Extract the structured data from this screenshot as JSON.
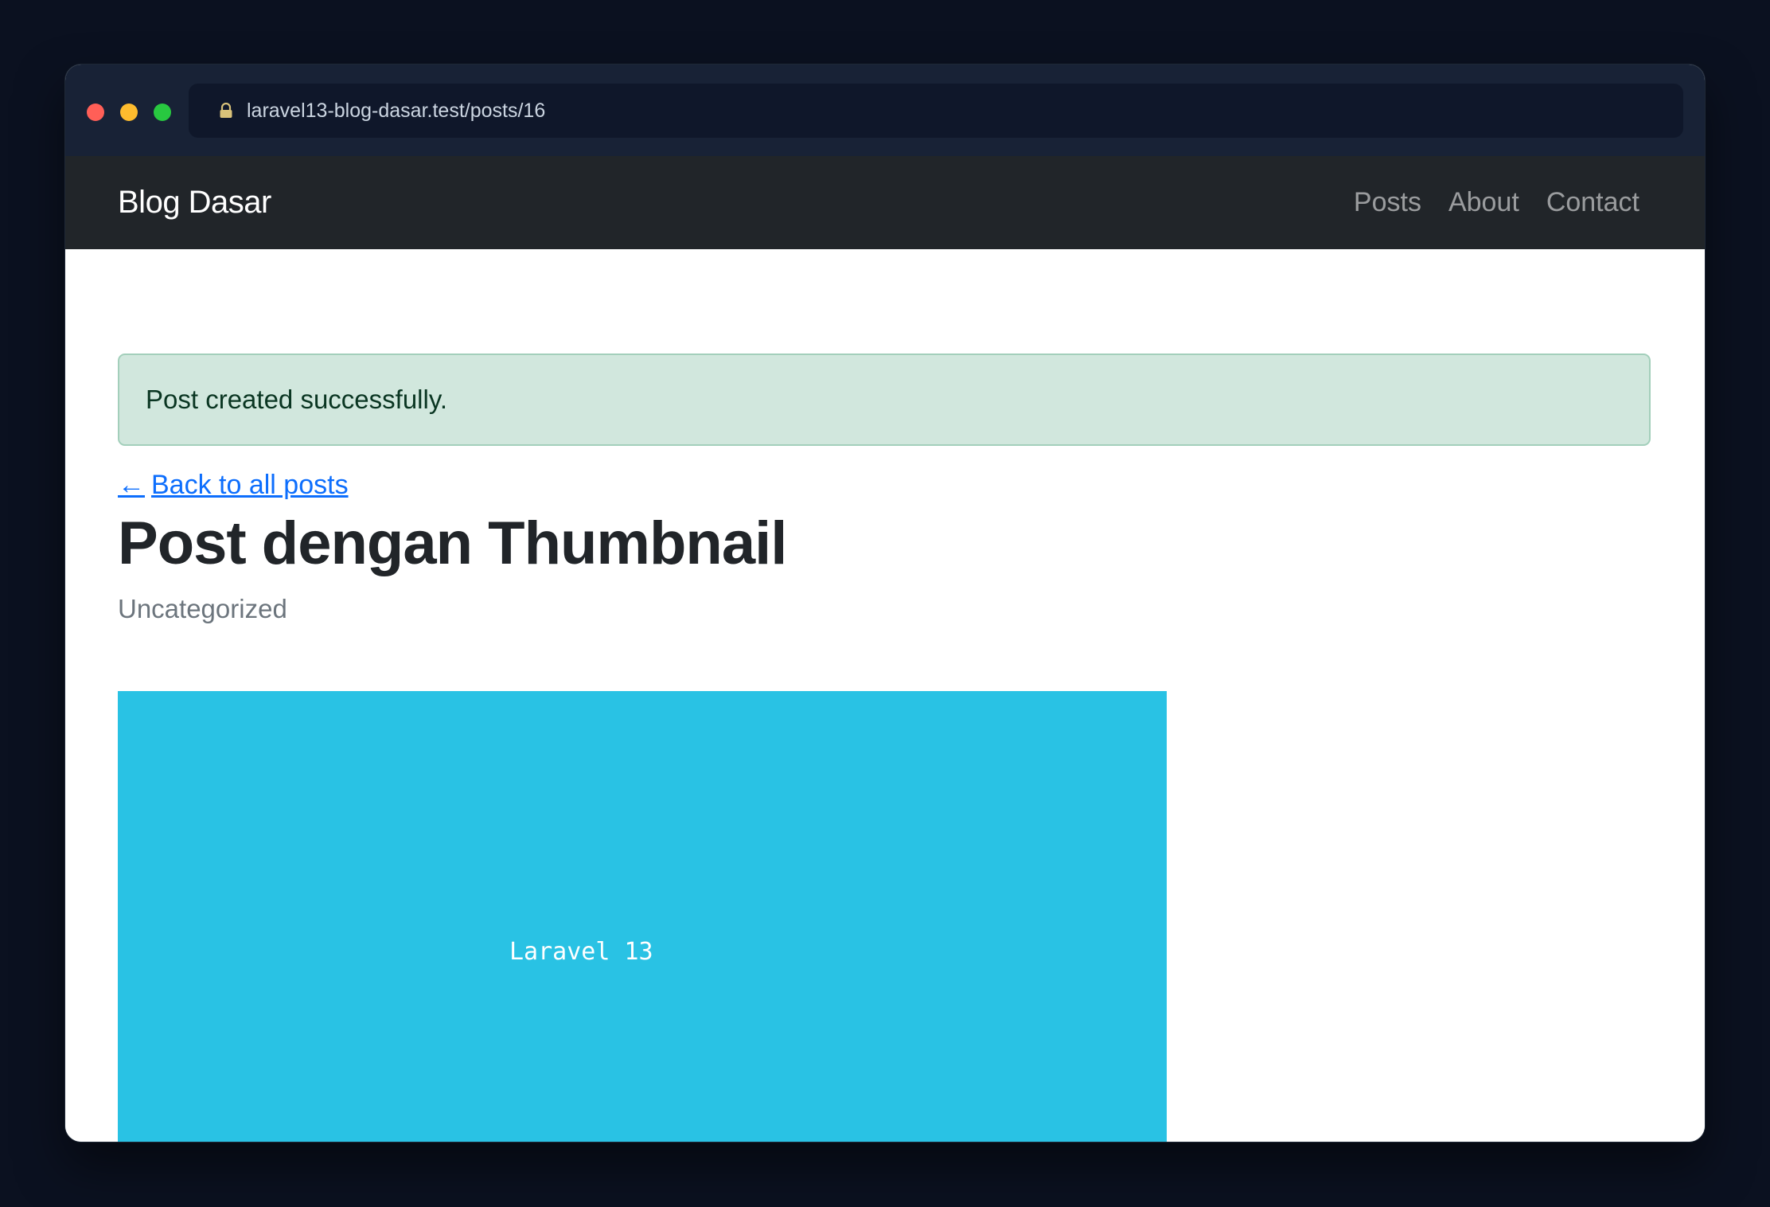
{
  "browser": {
    "url": "laravel13-blog-dasar.test/posts/16",
    "icons": [
      "lock-icon"
    ],
    "window_controls": [
      "close",
      "minimize",
      "maximize"
    ]
  },
  "navbar": {
    "brand": "Blog Dasar",
    "links": [
      "Posts",
      "About",
      "Contact"
    ]
  },
  "alert": {
    "message": "Post created successfully.",
    "color": "#d1e7dd"
  },
  "back_link": {
    "arrow": "←",
    "label": "Back to all posts"
  },
  "post": {
    "title": "Post dengan Thumbnail",
    "category": "Uncategorized",
    "thumbnail_text": "Laravel 13",
    "thumbnail_color": "#29c2e4"
  },
  "colors": {
    "background": "#0b1120",
    "navbar": "#212529",
    "link": "#0d6efd"
  }
}
